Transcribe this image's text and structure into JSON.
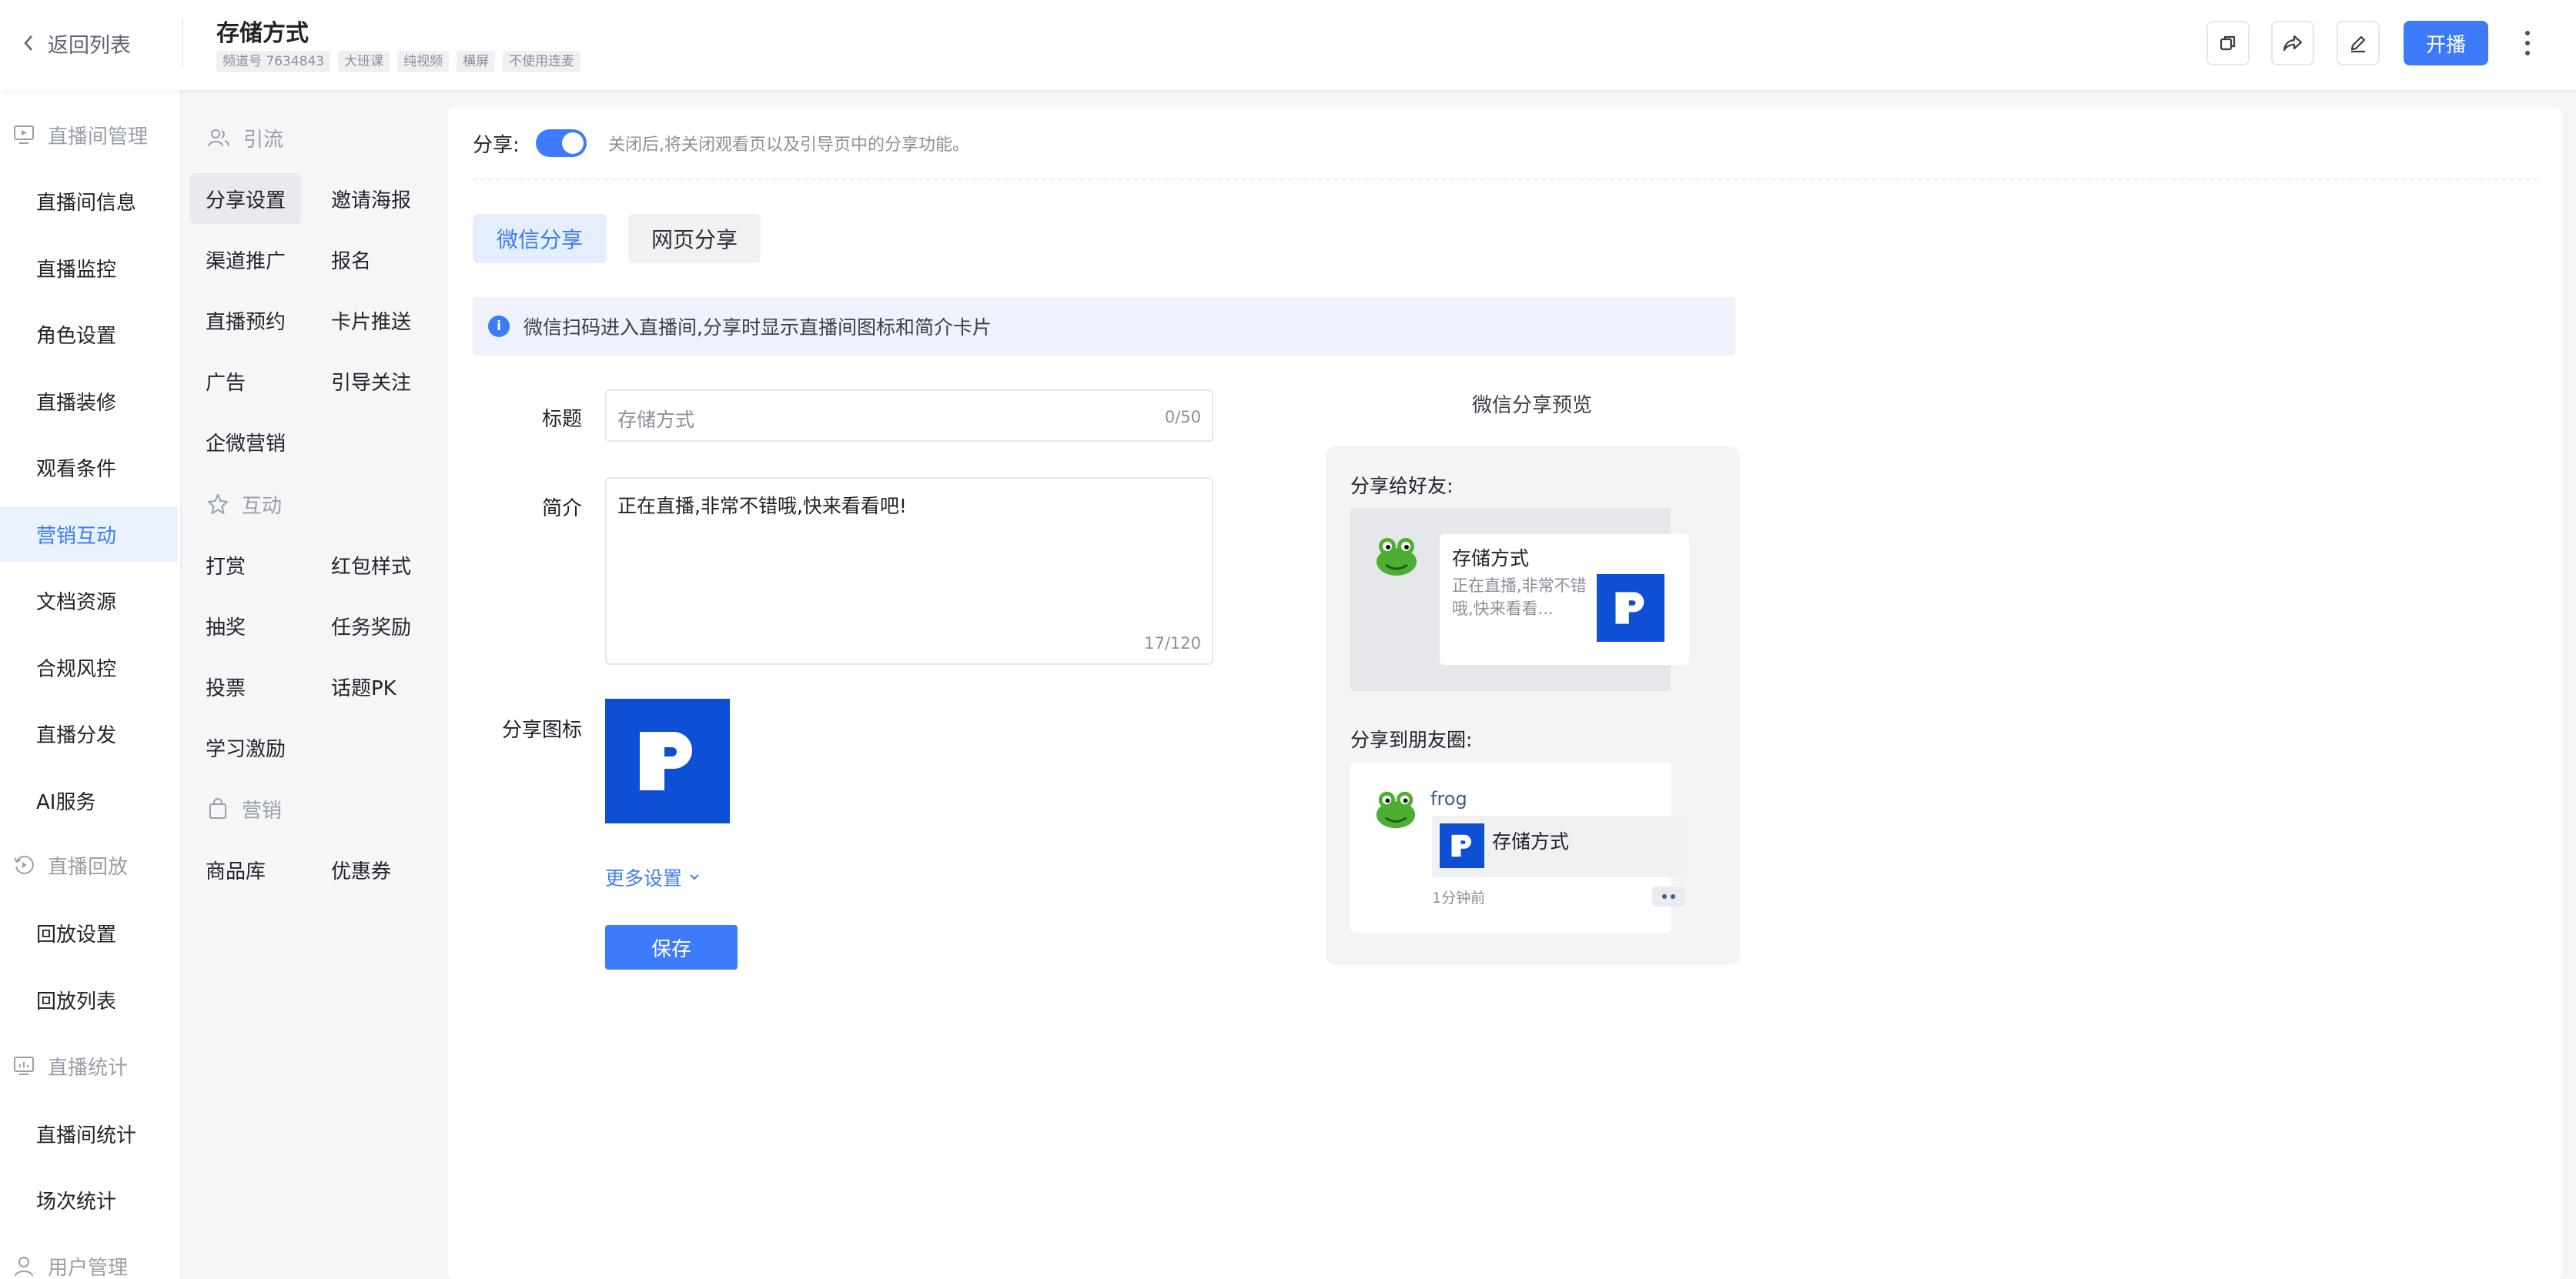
{
  "header": {
    "back_label": "返回列表",
    "title": "存储方式",
    "tags": [
      "频道号 7634843",
      "大班课",
      "纯视频",
      "横屏",
      "不使用连麦"
    ],
    "go_live_label": "开播"
  },
  "sidebar": {
    "groups": [
      {
        "label": "直播间管理",
        "icon": "monitor-icon",
        "items": [
          "直播间信息",
          "直播监控",
          "角色设置",
          "直播装修",
          "观看条件",
          "营销互动",
          "文档资源",
          "合规风控",
          "直播分发",
          "AI服务"
        ]
      },
      {
        "label": "直播回放",
        "icon": "replay-icon",
        "items": [
          "回放设置",
          "回放列表"
        ]
      },
      {
        "label": "直播统计",
        "icon": "chart-icon",
        "items": [
          "直播间统计",
          "场次统计"
        ]
      },
      {
        "label": "用户管理",
        "icon": "user-icon",
        "items": []
      }
    ],
    "active": "营销互动"
  },
  "submenu": {
    "groups": [
      {
        "label": "引流",
        "icon": "users-icon"
      },
      {
        "label": "互动",
        "icon": "star-icon"
      },
      {
        "label": "营销",
        "icon": "bag-icon"
      }
    ],
    "items": [
      [
        "分享设置",
        "邀请海报"
      ],
      [
        "渠道推广",
        "报名"
      ],
      [
        "直播预约",
        "卡片推送"
      ],
      [
        "广告",
        "引导关注"
      ],
      [
        "企微营销"
      ],
      [
        "打赏",
        "红包样式"
      ],
      [
        "抽奖",
        "任务奖励"
      ],
      [
        "投票",
        "话题PK"
      ],
      [
        "学习激励"
      ],
      [
        "商品库",
        "优惠券"
      ]
    ],
    "active": "分享设置"
  },
  "share": {
    "label": "分享:",
    "enabled": true,
    "hint": "关闭后,将关闭观看页以及引导页中的分享功能。",
    "tabs": [
      "微信分享",
      "网页分享"
    ],
    "active_tab": "微信分享",
    "info": "微信扫码进入直播间,分享时显示直播间图标和简介卡片",
    "title_label": "标题",
    "title_placeholder": "存储方式",
    "title_count": "0/50",
    "intro_label": "简介",
    "intro_value": "正在直播,非常不错哦,快来看看吧!",
    "intro_count": "17/120",
    "icon_label": "分享图标",
    "more_settings": "更多设置",
    "save_label": "保存"
  },
  "preview": {
    "title": "微信分享预览",
    "friend_label": "分享给好友:",
    "friend_card_title": "存储方式",
    "friend_card_desc": "正在直播,非常不错哦,快来看看...",
    "moments_label": "分享到朋友圈:",
    "moments_user": "frog",
    "moments_card_title": "存储方式",
    "moments_time": "1分钟前"
  },
  "colors": {
    "accent": "#3e7bfa",
    "brand_icon": "#0f4fd6",
    "active_bg": "#eaf1ff"
  }
}
